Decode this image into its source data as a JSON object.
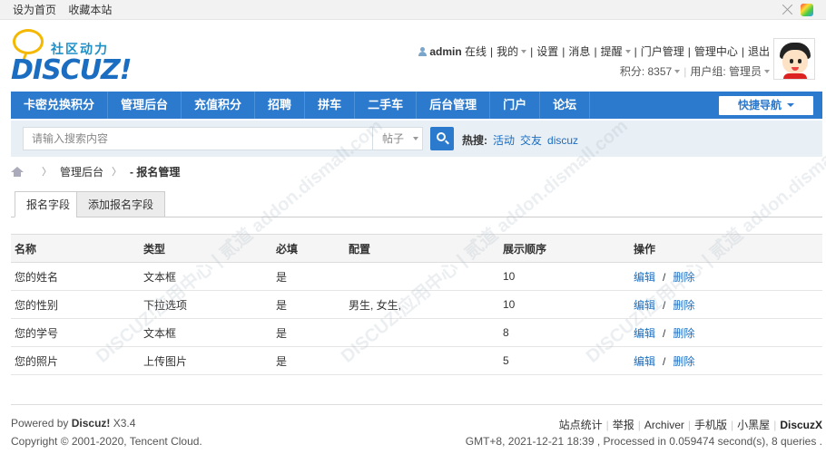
{
  "topbar": {
    "links": [
      "设为首页",
      "收藏本站"
    ]
  },
  "logo": {
    "cn": "社区动力",
    "text": "DISCUZ!"
  },
  "user": {
    "name": "admin",
    "status": "在线",
    "links": [
      "我的",
      "设置",
      "消息",
      "提醒",
      "门户管理",
      "管理中心",
      "退出"
    ],
    "points_label": "积分: 8357",
    "group_label": "用户组: 管理员"
  },
  "nav": {
    "items": [
      "卡密兑换积分",
      "管理后台",
      "充值积分",
      "招聘",
      "拼车",
      "二手车",
      "后台管理",
      "门户",
      "论坛"
    ],
    "quick": "快捷导航"
  },
  "search": {
    "placeholder": "请输入搜索内容",
    "type": "帖子",
    "hot_label": "热搜:",
    "hot": [
      "活动",
      "交友",
      "discuz"
    ]
  },
  "breadcrumb": {
    "items": [
      "管理后台"
    ],
    "current": "- 报名管理"
  },
  "tabs": [
    "报名字段",
    "添加报名字段"
  ],
  "table": {
    "headers": [
      "名称",
      "类型",
      "必填",
      "配置",
      "展示顺序",
      "操作"
    ],
    "rows": [
      {
        "name": "您的姓名",
        "type": "文本框",
        "required": "是",
        "config": "",
        "order": "10"
      },
      {
        "name": "您的性别",
        "type": "下拉选项",
        "required": "是",
        "config": "男生, 女生,",
        "order": "10"
      },
      {
        "name": "您的学号",
        "type": "文本框",
        "required": "是",
        "config": "",
        "order": "8"
      },
      {
        "name": "您的照片",
        "type": "上传图片",
        "required": "是",
        "config": "",
        "order": "5"
      }
    ],
    "edit": "编辑",
    "delete": "删除"
  },
  "footer": {
    "powered_prefix": "Powered by",
    "powered_brand": "Discuz!",
    "version": "X3.4",
    "copyright": "Copyright © 2001-2020, Tencent Cloud.",
    "links": [
      "站点统计",
      "举报",
      "Archiver",
      "手机版",
      "小黑屋"
    ],
    "brand": "DiscuzX",
    "gmt": "GMT+8, 2021-12-21 18:39 , Processed in 0.059474 second(s), 8 queries ."
  },
  "watermark": "DISCUZ!应用中心 | 贰道 addon.dismall.com",
  "colors": {
    "nav": "#2b7acd",
    "link": "#1a6dc0",
    "search_bg": "#e8eff5"
  }
}
